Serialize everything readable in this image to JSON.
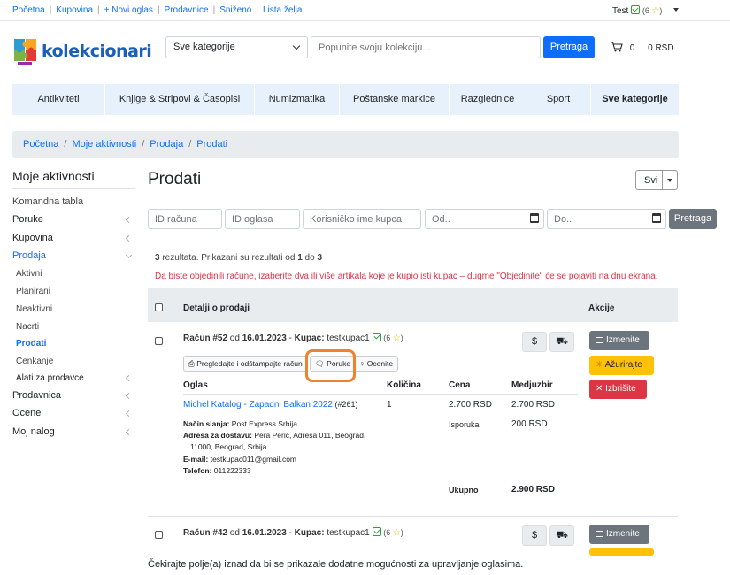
{
  "topbar": {
    "links": [
      "Početna",
      "Kupovina",
      "+ Novi oglas",
      "Prodavnice",
      "Sniženo",
      "Lista želja"
    ],
    "user": "Test",
    "rating": "(6",
    "rating_close": ")"
  },
  "header": {
    "logo_text": "kolekcionari",
    "category_select": "Sve kategorije",
    "search_placeholder": "Popunite svoju kolekciju...",
    "search_button": "Pretraga",
    "cart_count": "0",
    "cart_total": "0 RSD"
  },
  "nav": [
    "Antikviteti",
    "Knjige & Stripovi & Časopisi",
    "Numizmatika",
    "Poštanske markice",
    "Razglednice",
    "Sport",
    "Sve kategorije"
  ],
  "breadcrumb": [
    "Početna",
    "Moje aktivnosti",
    "Prodaja",
    "Prodati"
  ],
  "sidebar": {
    "title": "Moje aktivnosti",
    "items": {
      "dashboard": "Komandna tabla",
      "poruke": "Poruke",
      "kupovina": "Kupovina",
      "prodaja": "Prodaja",
      "aktivni": "Aktivni",
      "planirani": "Planirani",
      "neaktivni": "Neaktivni",
      "nacrti": "Nacrti",
      "prodati": "Prodati",
      "cenkanje": "Cenkanje",
      "alati": "Alati za prodavce",
      "prodavnica": "Prodavnica",
      "ocene": "Ocene",
      "nalog": "Moj nalog"
    }
  },
  "main": {
    "title": "Prodati",
    "filter_select": "Svi",
    "filters": {
      "id_racuna": "ID računa",
      "id_oglasa": "ID oglasa",
      "kupac": "Korisničko ime kupca",
      "od": "Od..",
      "do": "Do.."
    },
    "filter_button": "Pretraga",
    "results": {
      "count": "3",
      "text1": " rezultata. Prikazani su rezultati od ",
      "from": "1",
      "text2": " do ",
      "to": "3"
    },
    "notice": "Da biste objedinili račune, izaberite dva ili više artikala koje je kupio isti kupac – dugme \"Objedinite\" će se pojaviti na dnu ekrana.",
    "table_header": {
      "details": "Detalji o prodaji",
      "actions": "Akcije"
    },
    "order1": {
      "label": "Račun #52",
      "od": " od ",
      "date": "16.01.2023",
      "dash": " - ",
      "kupac_label": "Kupac:",
      "kupac": " testkupac1",
      "rating": "(6",
      "rating_close": ")",
      "btn_print": "Pregledajte i odštampajte račun",
      "btn_poruke": "Poruke",
      "btn_ocenite": "Ocenite",
      "cols": {
        "oglas": "Oglas",
        "kolicina": "Količina",
        "cena": "Cena",
        "medjuzbir": "Medjuzbir"
      },
      "item_title": "Michel Katalog - Zapadni Balkan 2022",
      "item_id": " (#261)",
      "qty": "1",
      "price": "2.700 RSD",
      "subtotal": "2.700 RSD",
      "shipping_label": "Isporuka",
      "shipping": "200 RSD",
      "nacin_label": "Način slanja:",
      "nacin": " Post Express Srbija",
      "adresa_label": "Adresa za dostavu:",
      "adresa1": " Pera Perić, Adresa 011, Beograd,",
      "adresa2": "11000, Beograd, Srbija",
      "email_label": "E-mail:",
      "email": " testkupac011@gmail.com",
      "telefon_label": "Telefon:",
      "telefon": " 011222333",
      "total_label": "Ukupno",
      "total": "2.900 RSD"
    },
    "order2": {
      "label": "Račun #42",
      "od": " od ",
      "date": "16.01.2023",
      "dash": " - ",
      "kupac_label": "Kupac:",
      "kupac": " testkupac1",
      "rating": "(6",
      "rating_close": ")"
    },
    "actions": {
      "edit": "Izmenite",
      "update": "Ažurirajte",
      "delete": "Izbrišite"
    },
    "footer_note": "Čekirajte polje(a) iznad da bi se prikazale dodatne mogućnosti za upravljanje oglasima."
  },
  "colors": {
    "primary": "#0d6efd",
    "danger": "#dc3545",
    "warning": "#ffc107",
    "secondary": "#6c757d",
    "highlight": "#f0822e"
  }
}
